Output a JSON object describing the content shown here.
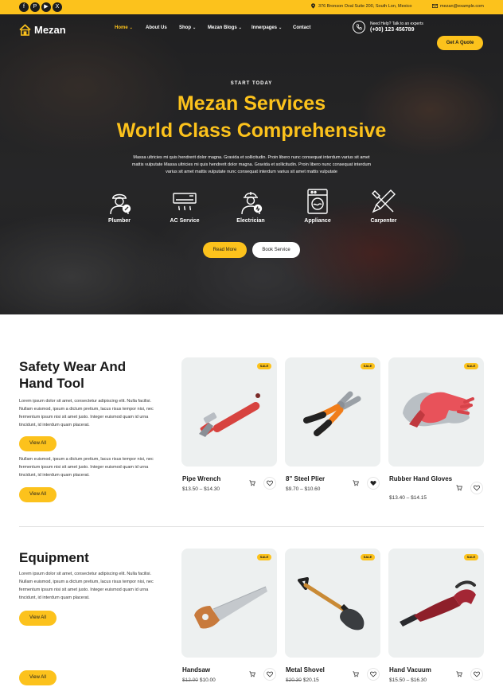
{
  "topbar": {
    "social": [
      {
        "name": "facebook-icon",
        "glyph": "f"
      },
      {
        "name": "pinterest-icon",
        "glyph": "P"
      },
      {
        "name": "youtube-icon",
        "glyph": "▶"
      },
      {
        "name": "x-twitter-icon",
        "glyph": "X"
      }
    ],
    "address": "376 Bronson Oval Suite 200, South Lon, Mexico",
    "email": "mezan@example.com"
  },
  "header": {
    "logo": "Mezan",
    "nav": [
      {
        "label": "Home",
        "dropdown": true,
        "active": true
      },
      {
        "label": "About Us",
        "dropdown": false,
        "active": false
      },
      {
        "label": "Shop",
        "dropdown": true,
        "active": false
      },
      {
        "label": "Mezan Blogs",
        "dropdown": true,
        "active": false
      },
      {
        "label": "Innerpages",
        "dropdown": true,
        "active": false
      },
      {
        "label": "Contact",
        "dropdown": false,
        "active": false
      }
    ],
    "help_label": "Need Help? Talk to an experts",
    "help_phone": "(+00) 123 456789",
    "quote_button": "Get A Quote"
  },
  "hero": {
    "kicker": "START TODAY",
    "title_line1": "Mezan Services",
    "title_line2": "World Class Comprehensive",
    "description": "Massa ultricies mi quis hendrerit dolor magna. Gravida et sollicitudin. Proin libero nunc consequat interdum varius sit amet mattis vulputate Massa ultricies mi quis hendrerit dolor magna. Gravida et sollicitudin. Proin libero nunc consequat interdum varius sit amet mattis vulputate nunc consequat interdum varius sit amet mattis vulputate",
    "services": [
      "Plumber",
      "AC Service",
      "Electrician",
      "Appliance",
      "Carpenter"
    ],
    "read_more": "Read More",
    "book_service": "Book Service"
  },
  "section1": {
    "title": "Safety Wear And Hand Tool",
    "description": "Lorem ipsum dolor sit amet, consectetur adipiscing elit. Nulla facilisi. Nullam euismod, ipsum a dictum pretium, lacus risus tempor nisi, nec fermentum ipsum nisi sit amet justo. Integer euismod quam id urna tincidunt, id interdum quam placerat.",
    "view_all": "View All",
    "overflow_text": "Nullam euismod, ipsum a dictum pretium, lacus risus tempor nisi, nec fermentum ipsum nisi sit amet justo. Integer euismod quam id urna tincidunt, id interdum quam placerat.",
    "view_all_2": "View All",
    "products": [
      {
        "name": "Pipe Wrench",
        "price": "$13.50 – $14.30",
        "old_price": "",
        "sale": "SALE",
        "wishlisted": false
      },
      {
        "name": "8'' Steel Plier",
        "price": "$9.70 – $10.60",
        "old_price": "",
        "sale": "SALE",
        "wishlisted": true
      },
      {
        "name": "Rubber Hand Gloves",
        "price": "$13.40 – $14.15",
        "old_price": "",
        "sale": "SALE",
        "wishlisted": false
      }
    ]
  },
  "section2": {
    "title": "Equipment",
    "description": "Lorem ipsum dolor sit amet, consectetur adipiscing elit. Nulla facilisi. Nullam euismod, ipsum a dictum pretium, lacus risus tempor nisi, nec fermentum ipsum nisi sit amet justo. Integer euismod quam id urna tincidunt, id interdum quam placerat.",
    "view_all": "View All",
    "view_all_2": "View All",
    "products": [
      {
        "name": "Handsaw",
        "price": "$10.00",
        "old_price": "$12.00",
        "sale": "SALE",
        "wishlisted": false
      },
      {
        "name": "Metal Shovel",
        "price": "$20.15",
        "old_price": "$20.30",
        "sale": "SALE",
        "wishlisted": false
      },
      {
        "name": "Hand Vacuum",
        "price": "$15.50 – $16.30",
        "old_price": "",
        "sale": "SALE",
        "wishlisted": false
      }
    ]
  },
  "colors": {
    "accent": "#fcc21c",
    "dark": "#1c1c1c",
    "card_bg": "#edf0f0"
  }
}
